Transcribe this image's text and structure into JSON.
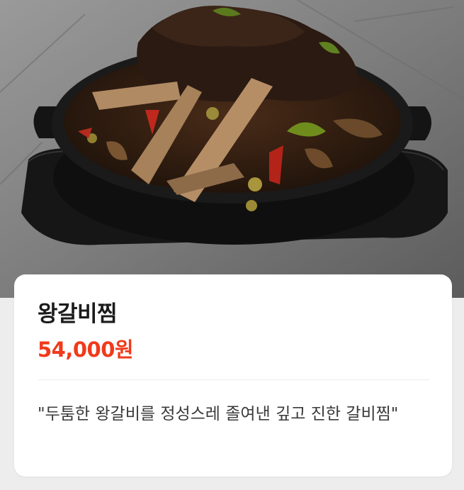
{
  "menu_item": {
    "image_alt": "braised galbi in black clay pot",
    "name": "왕갈비찜",
    "price": "54,000원",
    "description": "\"두툼한 왕갈비를 정성스레 졸여낸 깊고 진한 갈비찜\""
  },
  "colors": {
    "price": "#f03a1b",
    "card_bg": "#ffffff",
    "page_bg": "#ededed"
  }
}
